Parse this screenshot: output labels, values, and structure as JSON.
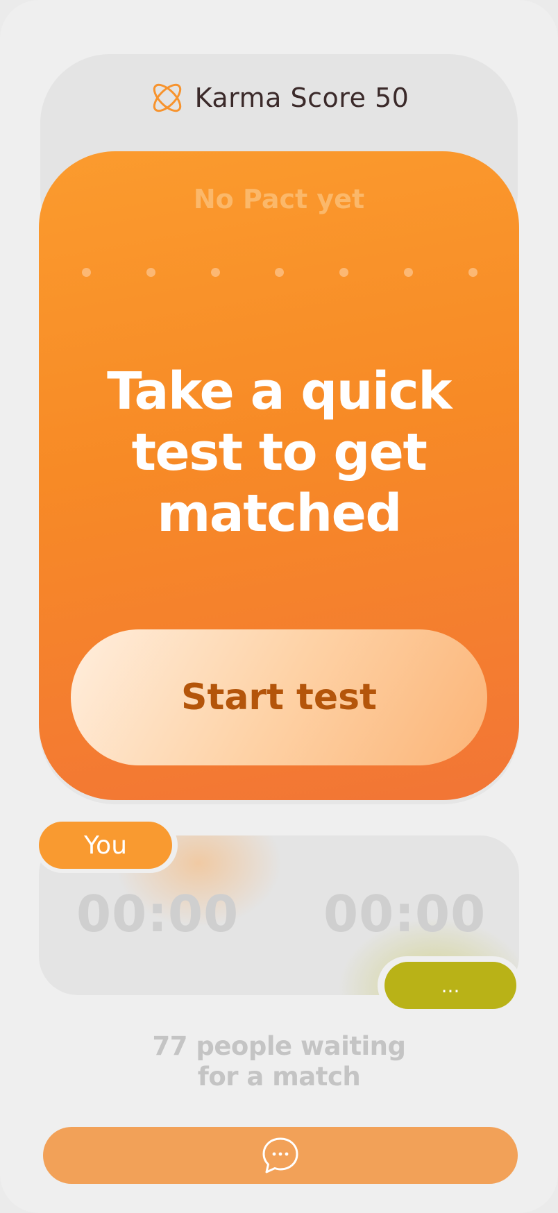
{
  "header": {
    "score_label": "Karma Score 50",
    "icon": "atom-orbit-icon"
  },
  "pact": {
    "status": "No Pact yet",
    "dots_count": 7,
    "headline": "Take a quick test to get matched",
    "start_button_label": "Start test"
  },
  "timers": {
    "you_label": "You",
    "you_time": "00:00",
    "partner_time": "00:00",
    "partner_label": "..."
  },
  "waiting_text": "77 people waiting\nfor a match",
  "chat": {
    "icon": "chat-bubble-icon"
  },
  "colors": {
    "accent": "#f78a26",
    "partner": "#b9b217",
    "button_text": "#b4550a"
  }
}
